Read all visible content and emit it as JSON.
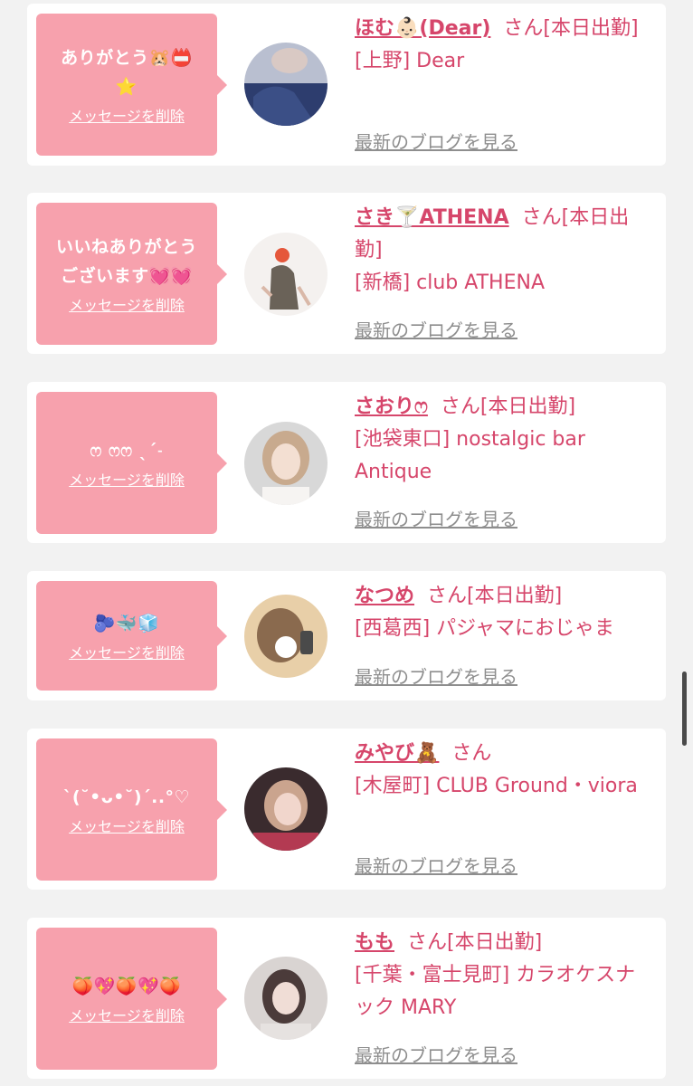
{
  "colors": {
    "bubble": "#f7a1ad",
    "accent": "#d6466b",
    "muted": "#8e8e8e",
    "background": "#f2f2f2"
  },
  "messages": [
    {
      "text": "ありがとう🐹📛\n⭐",
      "delete_label": "メッセージを削除",
      "cast_name": "ほむ👶🏻(Dear)",
      "suffix": "さん[本日出勤]",
      "shop": "[上野] Dear",
      "blog_label": "最新のブログを見る"
    },
    {
      "text": "いいねありがとう\nございます💓💓",
      "delete_label": "メッセージを削除",
      "cast_name": "さき🍸ATHENA",
      "suffix": "さん[本日出勤]",
      "shop": "[新橋] club ATHENA",
      "blog_label": "最新のブログを見る"
    },
    {
      "text": "ෆ ෆෆ ˎˊ˗",
      "delete_label": "メッセージを削除",
      "cast_name": "さおりෆ",
      "suffix": "さん[本日出勤]",
      "shop": "[池袋東口] nostalgic bar Antique",
      "blog_label": "最新のブログを見る"
    },
    {
      "text": "🫐🐳🧊",
      "delete_label": "メッセージを削除",
      "cast_name": "なつめ",
      "suffix": "さん[本日出勤]",
      "shop": "[西葛西] パジャマにおじゃま",
      "blog_label": "最新のブログを見る"
    },
    {
      "text": "ˋ(˘•ᴗ•˘)ˊ..°♡",
      "delete_label": "メッセージを削除",
      "cast_name": "みやび🧸",
      "suffix": "さん",
      "shop": "[木屋町] CLUB Ground・viora",
      "blog_label": "最新のブログを見る"
    },
    {
      "text": "🍑💖🍑💖🍑",
      "delete_label": "メッセージを削除",
      "cast_name": "もも",
      "suffix": "さん[本日出勤]",
      "shop": "[千葉・富士見町] カラオケスナック MARY",
      "blog_label": "最新のブログを見る"
    }
  ]
}
